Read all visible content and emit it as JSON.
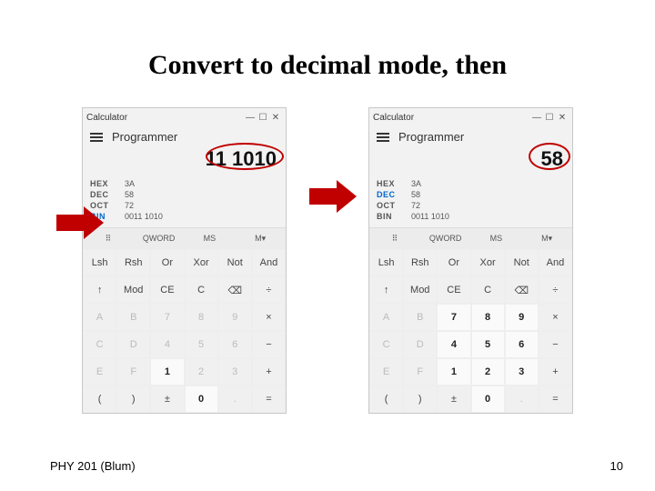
{
  "slide": {
    "title": "Convert to decimal mode, then",
    "footer_left": "PHY 201 (Blum)",
    "footer_right": "10"
  },
  "calc_left": {
    "window_title": "Calculator",
    "mode": "Programmer",
    "display": "11 1010",
    "bases": {
      "hex": {
        "label": "HEX",
        "value": "3A"
      },
      "dec": {
        "label": "DEC",
        "value": "58"
      },
      "oct": {
        "label": "OCT",
        "value": "72"
      },
      "bin": {
        "label": "BIN",
        "value": "0011 1010"
      }
    },
    "toolbar": {
      "grid_icon": "⠿",
      "word": "QWORD",
      "ms": "MS",
      "mv": "M▾"
    },
    "keys": [
      [
        "Lsh",
        "Rsh",
        "Or",
        "Xor",
        "Not",
        "And"
      ],
      [
        "↑",
        "Mod",
        "CE",
        "C",
        "⌫",
        "÷"
      ],
      [
        "A",
        "B",
        "7",
        "8",
        "9",
        "×"
      ],
      [
        "C",
        "D",
        "4",
        "5",
        "6",
        "−"
      ],
      [
        "E",
        "F",
        "1",
        "2",
        "3",
        "+"
      ],
      [
        "(",
        ")",
        "±",
        "0",
        ".",
        "="
      ]
    ],
    "circle": true
  },
  "calc_right": {
    "window_title": "Calculator",
    "mode": "Programmer",
    "display": "58",
    "bases": {
      "hex": {
        "label": "HEX",
        "value": "3A"
      },
      "dec": {
        "label": "DEC",
        "value": "58"
      },
      "oct": {
        "label": "OCT",
        "value": "72"
      },
      "bin": {
        "label": "BIN",
        "value": "0011 1010"
      }
    },
    "toolbar": {
      "grid_icon": "⠿",
      "word": "QWORD",
      "ms": "MS",
      "mv": "M▾"
    },
    "keys": [
      [
        "Lsh",
        "Rsh",
        "Or",
        "Xor",
        "Not",
        "And"
      ],
      [
        "↑",
        "Mod",
        "CE",
        "C",
        "⌫",
        "÷"
      ],
      [
        "A",
        "B",
        "7",
        "8",
        "9",
        "×"
      ],
      [
        "C",
        "D",
        "4",
        "5",
        "6",
        "−"
      ],
      [
        "E",
        "F",
        "1",
        "2",
        "3",
        "+"
      ],
      [
        "(",
        ")",
        "±",
        "0",
        ".",
        "="
      ]
    ],
    "circle": true
  },
  "colors": {
    "arrow": "#c00000"
  }
}
